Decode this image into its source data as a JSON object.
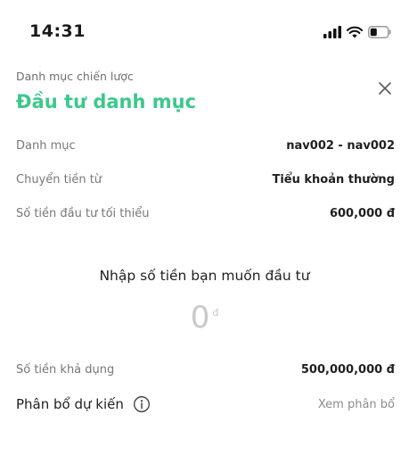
{
  "status_bar": {
    "time": "14:31"
  },
  "header": {
    "subtitle": "Danh mục chiến lược",
    "title": "Đầu tư danh mục",
    "accent_color": "#3cc88c"
  },
  "details": [
    {
      "label": "Danh mục",
      "value": "nav002 - nav002"
    },
    {
      "label": "Chuyển tiền từ",
      "value": "Tiểu khoản thường"
    },
    {
      "label": "Số tiền đầu tư tối thiểu",
      "value": "600,000 đ"
    }
  ],
  "input": {
    "prompt": "Nhập số tiền bạn muốn đầu tư",
    "amount": "0",
    "unit": "đ"
  },
  "available": {
    "label": "Số tiền khả dụng",
    "value": "500,000,000 đ"
  },
  "allocation": {
    "label": "Phân bổ dự kiến",
    "link": "Xem phân bổ"
  },
  "icons": {
    "close": "close-icon",
    "info": "info-icon",
    "signal": "signal-icon",
    "wifi": "wifi-icon",
    "battery": "battery-icon"
  }
}
